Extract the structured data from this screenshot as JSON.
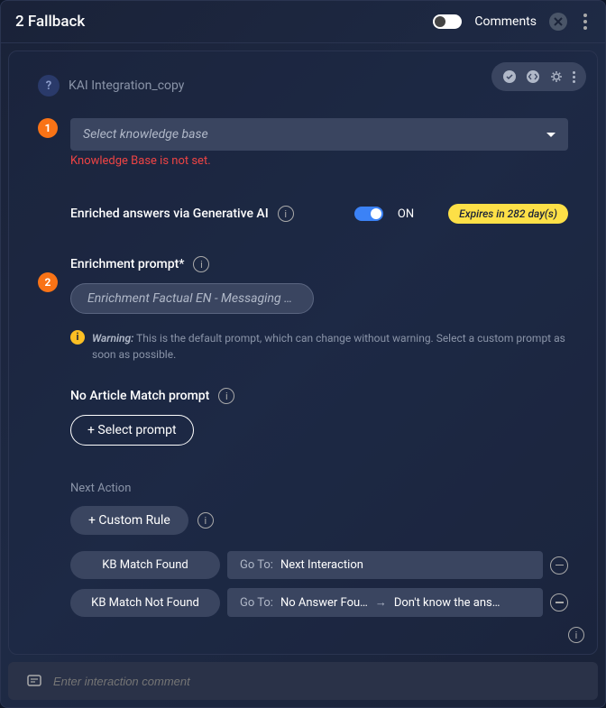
{
  "titlebar": {
    "title": "2 Fallback",
    "comments_label": "Comments"
  },
  "subtitle": "KAI Integration_copy",
  "step1": {
    "num": "1",
    "dropdown_placeholder": "Select knowledge base",
    "error": "Knowledge Base is not set."
  },
  "enriched": {
    "label": "Enriched answers via Generative AI",
    "toggle_state": "ON",
    "expires": "Expires in 282 day(s)"
  },
  "step2": {
    "num": "2",
    "label": "Enrichment prompt*",
    "chip": "Enrichment Factual EN - Messaging …",
    "warn_label": "Warning:",
    "warn_text": "This is the default prompt, which can change without warning. Select a custom prompt as soon as possible."
  },
  "no_match": {
    "label": "No Article Match prompt",
    "button": "+ Select prompt"
  },
  "next_action": {
    "label": "Next Action",
    "custom_rule": "+ Custom Rule",
    "rules": [
      {
        "condition": "KB Match Found",
        "goto_prefix": "Go To:",
        "target": "Next Interaction"
      },
      {
        "condition": "KB Match Not Found",
        "goto_prefix": "Go To:",
        "target1": "No Answer Fou…",
        "target2": "Don't know the ans…"
      }
    ]
  },
  "footer": {
    "placeholder": "Enter interaction comment"
  }
}
